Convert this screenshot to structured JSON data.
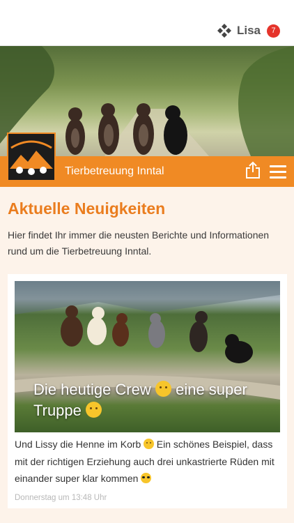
{
  "header": {
    "user_name": "Lisa",
    "notification_count": "7",
    "app_icon": "app-logo-icon"
  },
  "banner": {
    "site_title": "Tierbetreuung Inntal",
    "accent_color": "#f08a24"
  },
  "main": {
    "section_title": "Aktuelle Neuigkeiten",
    "intro": "Hier findet Ihr immer die neusten Berichte und Informationen rund um die Tierbetreuung Inntal."
  },
  "post": {
    "caption_part1": "Die heutige Crew ",
    "caption_part2": " eine super Truppe ",
    "text_part1": "Und Lissy die Henne im Korb ",
    "text_part2": " Ein schönes Beispiel, dass mit der richtigen Erziehung auch drei unkastrierte Rüden mit einander super klar kommen ",
    "timestamp": "Donnerstag um 13:48 Uhr"
  }
}
